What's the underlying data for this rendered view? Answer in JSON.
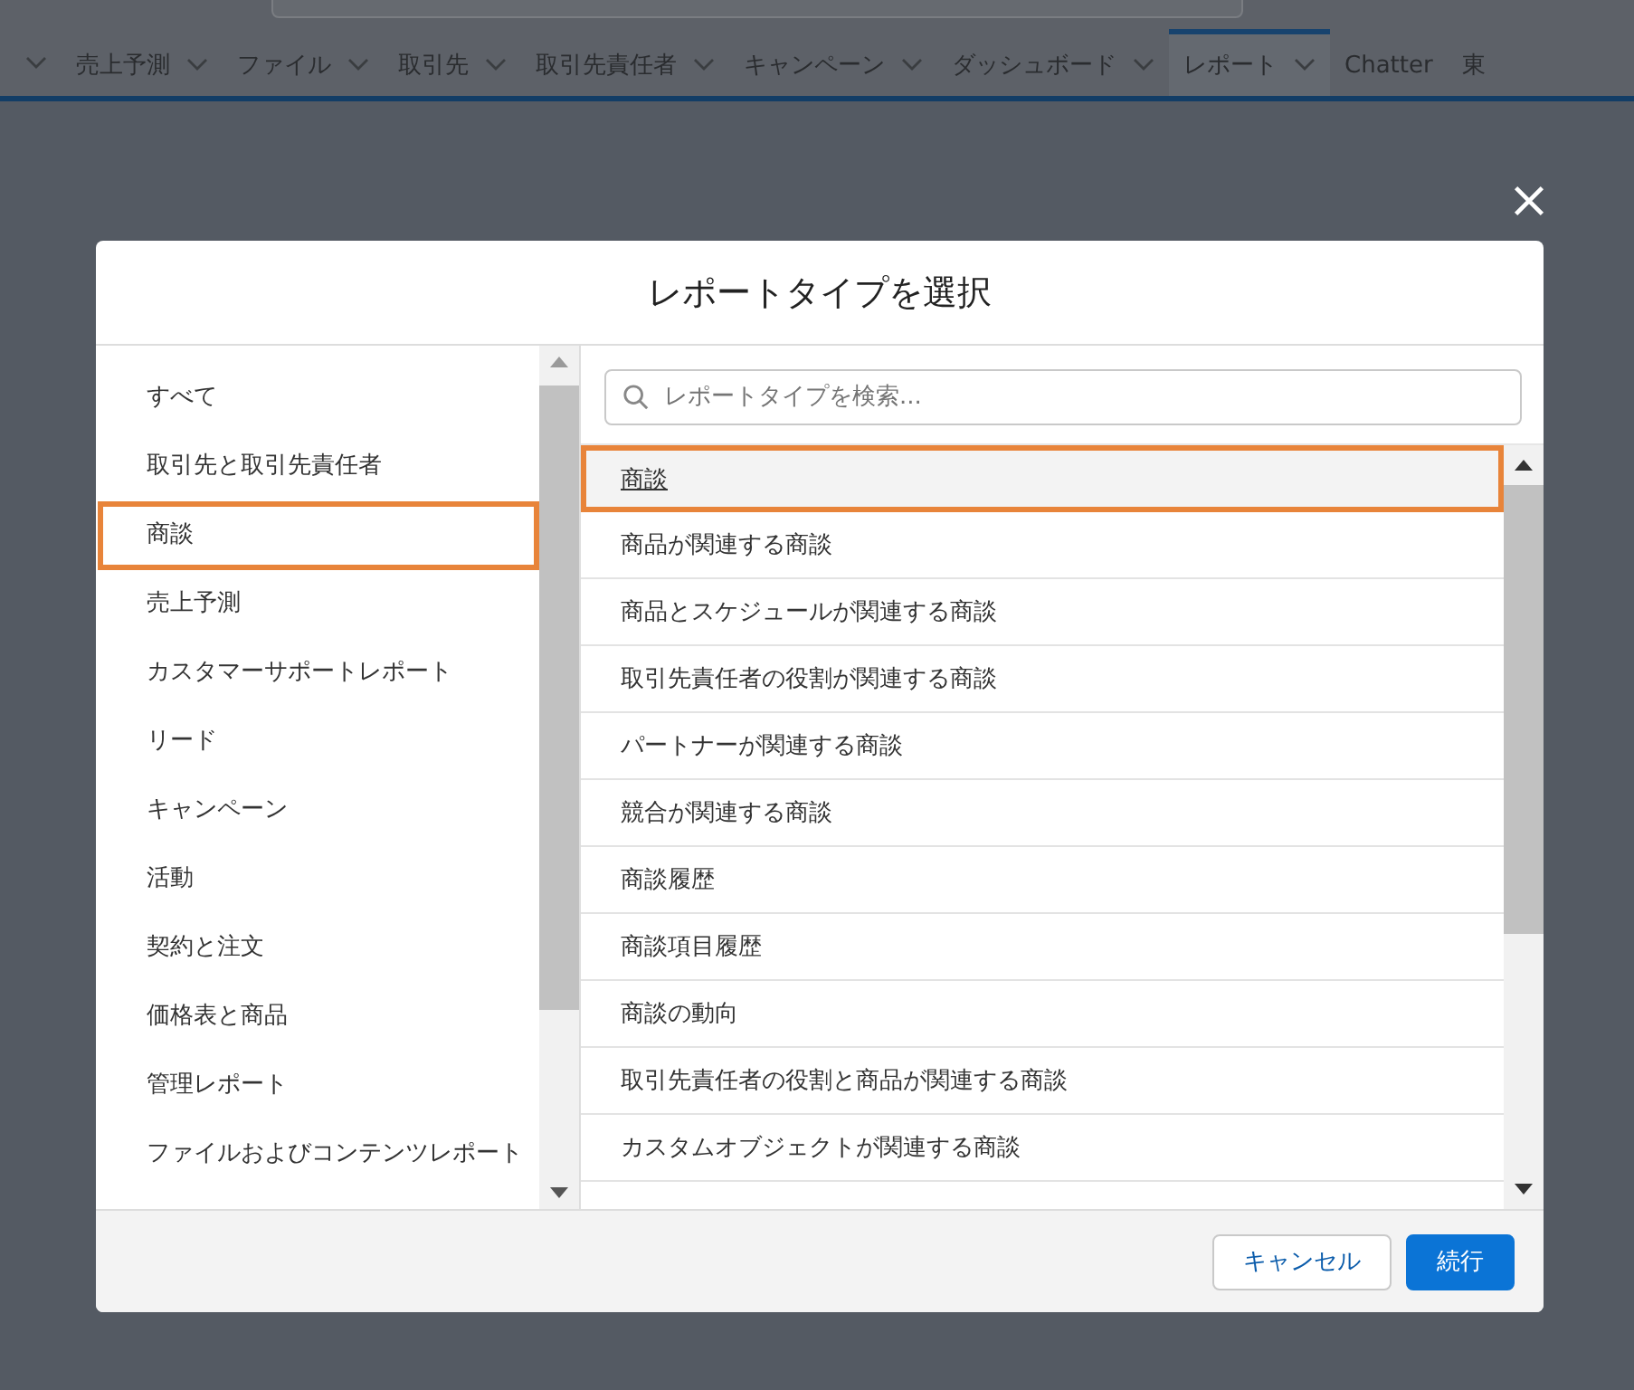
{
  "nav_tabs": [
    {
      "label": "売上予測",
      "dropdown": true,
      "selected": false
    },
    {
      "label": "ファイル",
      "dropdown": true,
      "selected": false
    },
    {
      "label": "取引先",
      "dropdown": true,
      "selected": false
    },
    {
      "label": "取引先責任者",
      "dropdown": true,
      "selected": false
    },
    {
      "label": "キャンペーン",
      "dropdown": true,
      "selected": false
    },
    {
      "label": "ダッシュボード",
      "dropdown": true,
      "selected": false
    },
    {
      "label": "レポート",
      "dropdown": true,
      "selected": true
    },
    {
      "label": "Chatter",
      "dropdown": false,
      "selected": false
    },
    {
      "label": "東",
      "dropdown": false,
      "selected": false
    }
  ],
  "dialog": {
    "title": "レポートタイプを選択",
    "categories": [
      {
        "label": "すべて",
        "selected": false
      },
      {
        "label": "取引先と取引先責任者",
        "selected": false
      },
      {
        "label": "商談",
        "selected": true
      },
      {
        "label": "売上予測",
        "selected": false
      },
      {
        "label": "カスタマーサポートレポート",
        "selected": false
      },
      {
        "label": "リード",
        "selected": false
      },
      {
        "label": "キャンペーン",
        "selected": false
      },
      {
        "label": "活動",
        "selected": false
      },
      {
        "label": "契約と注文",
        "selected": false
      },
      {
        "label": "価格表と商品",
        "selected": false
      },
      {
        "label": "管理レポート",
        "selected": false
      },
      {
        "label": "ファイルおよびコンテンツレポート",
        "selected": false
      }
    ],
    "search": {
      "placeholder": "レポートタイプを検索..."
    },
    "report_types": [
      {
        "label": "商談",
        "selected": true
      },
      {
        "label": "商品が関連する商談",
        "selected": false
      },
      {
        "label": "商品とスケジュールが関連する商談",
        "selected": false
      },
      {
        "label": "取引先責任者の役割が関連する商談",
        "selected": false
      },
      {
        "label": "パートナーが関連する商談",
        "selected": false
      },
      {
        "label": "競合が関連する商談",
        "selected": false
      },
      {
        "label": "商談履歴",
        "selected": false
      },
      {
        "label": "商談項目履歴",
        "selected": false
      },
      {
        "label": "商談の動向",
        "selected": false
      },
      {
        "label": "取引先責任者の役割と商品が関連する商談",
        "selected": false
      },
      {
        "label": "カスタムオブジェクトが関連する商談",
        "selected": false
      }
    ],
    "buttons": [
      {
        "label": "キャンセル",
        "kind": "neutral"
      },
      {
        "label": "続行",
        "kind": "brand"
      }
    ]
  }
}
